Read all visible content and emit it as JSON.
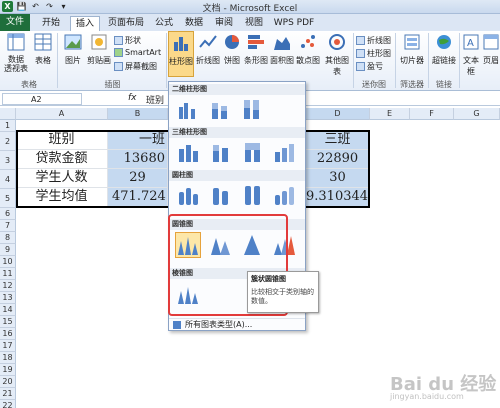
{
  "window": {
    "title": "文档 - Microsoft Excel"
  },
  "tabs": [
    "文件",
    "开始",
    "插入",
    "页面布局",
    "公式",
    "数据",
    "审阅",
    "视图",
    "WPS PDF"
  ],
  "ribbon": {
    "pivot": "数据\n透视表",
    "table": "表格",
    "picture": "图片",
    "clipart": "剪贴画",
    "shapes": "形状",
    "smartart": "SmartArt",
    "screenshot": "屏幕截图",
    "col": "柱形图",
    "line": "折线图",
    "pie": "饼图",
    "bar": "条形图",
    "area": "面积图",
    "scatter": "散点图",
    "other": "其他图表",
    "spark_line": "折线图",
    "spark_col": "柱形图",
    "spark_win": "盈亏",
    "slicer": "切片器",
    "hyperlink": "超链接",
    "textbox": "文本框",
    "header": "页眉",
    "grp_tables": "表格",
    "grp_illus": "插图",
    "grp_spark": "迷你图",
    "grp_filter": "筛选器",
    "grp_links": "链接"
  },
  "formula_bar": {
    "name_box": "A2",
    "fx": "fx",
    "value": "班别"
  },
  "columns": [
    "A",
    "B",
    "C",
    "D",
    "E",
    "F",
    "G"
  ],
  "rows": [
    "1",
    "2",
    "3",
    "4",
    "5",
    "6",
    "7",
    "8",
    "9",
    "10",
    "11",
    "12",
    "13",
    "14",
    "15",
    "16",
    "17",
    "18",
    "19",
    "20",
    "21",
    "22",
    "23"
  ],
  "sheet": {
    "r2": [
      "班别",
      "一班",
      "三班"
    ],
    "r3": [
      "贷款金额",
      "13680",
      "22890"
    ],
    "r4": [
      "学生人数",
      "29",
      "30"
    ],
    "r5": [
      "学生均值",
      "471.7241",
      "9.3103448"
    ]
  },
  "dropdown": {
    "sec1": "二维柱形图",
    "sec2": "三维柱形图",
    "sec3": "圆柱图",
    "sec4": "圆锥图",
    "sec5": "棱锥图",
    "footer": "所有图表类型(A)..."
  },
  "tooltip": {
    "title": "簇状圆锥图",
    "body": "比较相交于类别轴的数值。"
  },
  "watermark": {
    "main": "Bai du 经验",
    "sub": "jingyan.baidu.com"
  }
}
